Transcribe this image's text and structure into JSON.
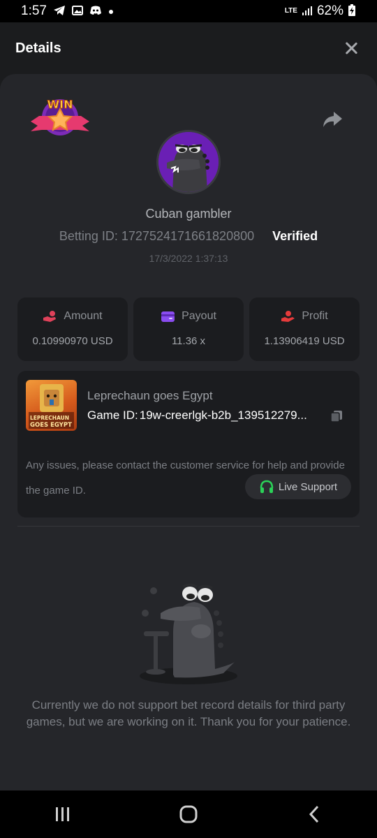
{
  "status_bar": {
    "time": "1:57",
    "network": "LTE",
    "battery": "62%"
  },
  "header": {
    "title": "Details"
  },
  "badge": {
    "text": "WIN"
  },
  "user": {
    "name": "Cuban gambler",
    "betting_id": "Betting ID: 1727524171661820800",
    "verified": "Verified",
    "timestamp": "17/3/2022 1:37:13"
  },
  "stats": [
    {
      "label": "Amount",
      "value": "0.10990970 USD",
      "icon": "hand-coins-icon",
      "color": "#e0415a"
    },
    {
      "label": "Payout",
      "value": "11.36 x",
      "icon": "wallet-icon",
      "color": "#8a4cf0"
    },
    {
      "label": "Profit",
      "value": "1.13906419 USD",
      "icon": "hand-money-icon",
      "color": "#e53b3b"
    }
  ],
  "game": {
    "name": "Leprechaun goes Egypt",
    "id_label": "Game ID:",
    "id_value": "19w-creerlgk-b2b_139512279...",
    "thumb_text_top": "LEPRECHAUN",
    "thumb_text_bottom": "GOES EGYPT"
  },
  "support": {
    "message": "Any issues, please contact the customer service for help and provide the game ID.",
    "button": "Live Support",
    "accent": "#2bd158"
  },
  "notice": {
    "text": "Currently we do not support bet record details for third party games, but we are working on it. Thank you for your patience."
  },
  "colors": {
    "background": "#1b1c1e",
    "panel": "#25262a",
    "card": "#1b1c1f"
  }
}
